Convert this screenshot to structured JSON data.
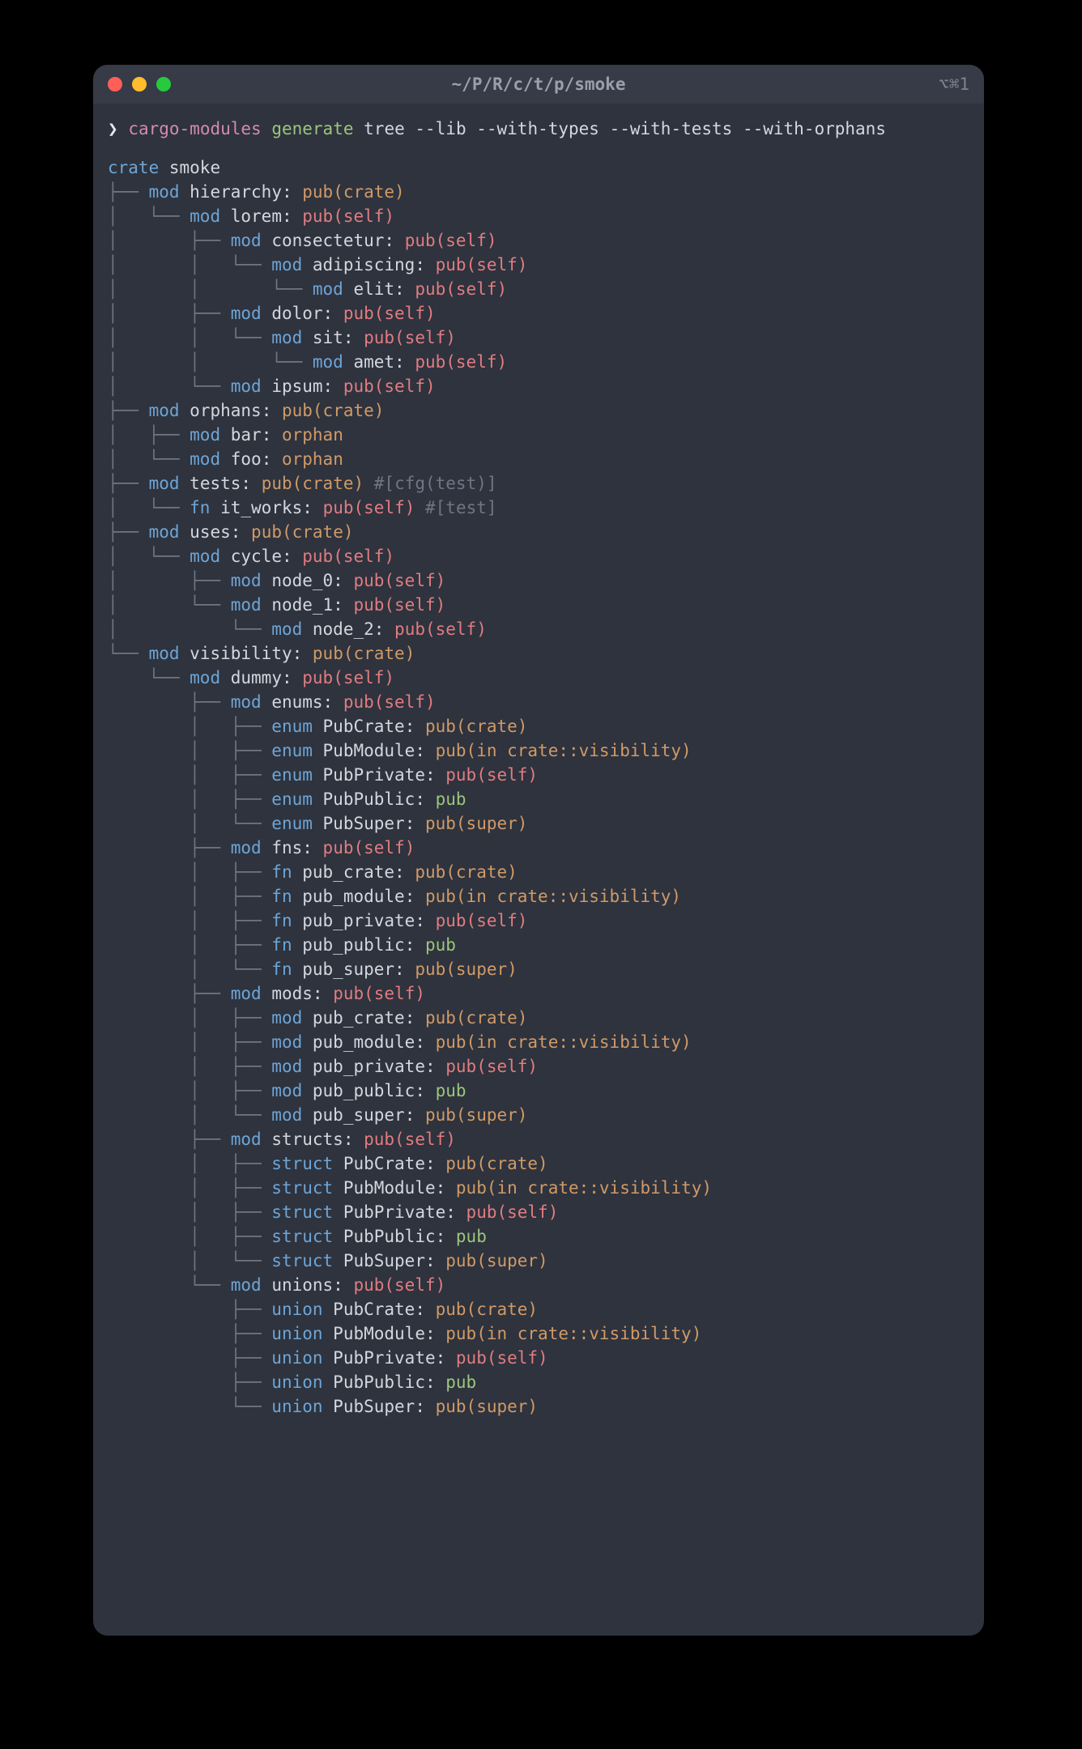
{
  "window": {
    "title": "~/P/R/c/t/p/smoke",
    "shortcut": "⌥⌘1"
  },
  "prompt": {
    "symbol": "❯",
    "binary": "cargo-modules",
    "subcmd": "generate",
    "args": "tree --lib --with-types --with-tests --with-orphans"
  },
  "root": {
    "kw": "crate",
    "name": "smoke"
  },
  "tree": [
    {
      "d": 1,
      "conn": "├── ",
      "kw": "mod",
      "name": "hierarchy",
      "vis": "pub(crate)",
      "vcls": "c-orange"
    },
    {
      "d": 1,
      "conn": "│   └── ",
      "kw": "mod",
      "name": "lorem",
      "vis": "pub(self)",
      "vcls": "c-salmon"
    },
    {
      "d": 1,
      "conn": "│       ├── ",
      "kw": "mod",
      "name": "consectetur",
      "vis": "pub(self)",
      "vcls": "c-salmon"
    },
    {
      "d": 1,
      "conn": "│       │   └── ",
      "kw": "mod",
      "name": "adipiscing",
      "vis": "pub(self)",
      "vcls": "c-salmon"
    },
    {
      "d": 1,
      "conn": "│       │       └── ",
      "kw": "mod",
      "name": "elit",
      "vis": "pub(self)",
      "vcls": "c-salmon"
    },
    {
      "d": 1,
      "conn": "│       ├── ",
      "kw": "mod",
      "name": "dolor",
      "vis": "pub(self)",
      "vcls": "c-salmon"
    },
    {
      "d": 1,
      "conn": "│       │   └── ",
      "kw": "mod",
      "name": "sit",
      "vis": "pub(self)",
      "vcls": "c-salmon"
    },
    {
      "d": 1,
      "conn": "│       │       └── ",
      "kw": "mod",
      "name": "amet",
      "vis": "pub(self)",
      "vcls": "c-salmon"
    },
    {
      "d": 1,
      "conn": "│       └── ",
      "kw": "mod",
      "name": "ipsum",
      "vis": "pub(self)",
      "vcls": "c-salmon"
    },
    {
      "d": 1,
      "conn": "├── ",
      "kw": "mod",
      "name": "orphans",
      "vis": "pub(crate)",
      "vcls": "c-orange"
    },
    {
      "d": 1,
      "conn": "│   ├── ",
      "kw": "mod",
      "name": "bar",
      "vis": "orphan",
      "vcls": "c-orange"
    },
    {
      "d": 1,
      "conn": "│   └── ",
      "kw": "mod",
      "name": "foo",
      "vis": "orphan",
      "vcls": "c-orange"
    },
    {
      "d": 1,
      "conn": "├── ",
      "kw": "mod",
      "name": "tests",
      "vis": "pub(crate)",
      "vcls": "c-orange",
      "attr": "#[cfg(test)]"
    },
    {
      "d": 1,
      "conn": "│   └── ",
      "kw": "fn",
      "name": "it_works",
      "vis": "pub(self)",
      "vcls": "c-salmon",
      "attr": "#[test]"
    },
    {
      "d": 1,
      "conn": "├── ",
      "kw": "mod",
      "name": "uses",
      "vis": "pub(crate)",
      "vcls": "c-orange"
    },
    {
      "d": 1,
      "conn": "│   └── ",
      "kw": "mod",
      "name": "cycle",
      "vis": "pub(self)",
      "vcls": "c-salmon"
    },
    {
      "d": 1,
      "conn": "│       ├── ",
      "kw": "mod",
      "name": "node_0",
      "vis": "pub(self)",
      "vcls": "c-salmon"
    },
    {
      "d": 1,
      "conn": "│       └── ",
      "kw": "mod",
      "name": "node_1",
      "vis": "pub(self)",
      "vcls": "c-salmon"
    },
    {
      "d": 1,
      "conn": "│           └── ",
      "kw": "mod",
      "name": "node_2",
      "vis": "pub(self)",
      "vcls": "c-salmon"
    },
    {
      "d": 1,
      "conn": "└── ",
      "kw": "mod",
      "name": "visibility",
      "vis": "pub(crate)",
      "vcls": "c-orange"
    },
    {
      "d": 1,
      "conn": "    └── ",
      "kw": "mod",
      "name": "dummy",
      "vis": "pub(self)",
      "vcls": "c-salmon"
    },
    {
      "d": 1,
      "conn": "        ├── ",
      "kw": "mod",
      "name": "enums",
      "vis": "pub(self)",
      "vcls": "c-salmon"
    },
    {
      "d": 1,
      "conn": "        │   ├── ",
      "kw": "enum",
      "name": "PubCrate",
      "vis": "pub(crate)",
      "vcls": "c-orange"
    },
    {
      "d": 1,
      "conn": "        │   ├── ",
      "kw": "enum",
      "name": "PubModule",
      "vis": "pub(in crate::visibility)",
      "vcls": "c-orange"
    },
    {
      "d": 1,
      "conn": "        │   ├── ",
      "kw": "enum",
      "name": "PubPrivate",
      "vis": "pub(self)",
      "vcls": "c-salmon"
    },
    {
      "d": 1,
      "conn": "        │   ├── ",
      "kw": "enum",
      "name": "PubPublic",
      "vis": "pub",
      "vcls": "c-green"
    },
    {
      "d": 1,
      "conn": "        │   └── ",
      "kw": "enum",
      "name": "PubSuper",
      "vis": "pub(super)",
      "vcls": "c-orange"
    },
    {
      "d": 1,
      "conn": "        ├── ",
      "kw": "mod",
      "name": "fns",
      "vis": "pub(self)",
      "vcls": "c-salmon"
    },
    {
      "d": 1,
      "conn": "        │   ├── ",
      "kw": "fn",
      "name": "pub_crate",
      "vis": "pub(crate)",
      "vcls": "c-orange"
    },
    {
      "d": 1,
      "conn": "        │   ├── ",
      "kw": "fn",
      "name": "pub_module",
      "vis": "pub(in crate::visibility)",
      "vcls": "c-orange"
    },
    {
      "d": 1,
      "conn": "        │   ├── ",
      "kw": "fn",
      "name": "pub_private",
      "vis": "pub(self)",
      "vcls": "c-salmon"
    },
    {
      "d": 1,
      "conn": "        │   ├── ",
      "kw": "fn",
      "name": "pub_public",
      "vis": "pub",
      "vcls": "c-green"
    },
    {
      "d": 1,
      "conn": "        │   └── ",
      "kw": "fn",
      "name": "pub_super",
      "vis": "pub(super)",
      "vcls": "c-orange"
    },
    {
      "d": 1,
      "conn": "        ├── ",
      "kw": "mod",
      "name": "mods",
      "vis": "pub(self)",
      "vcls": "c-salmon"
    },
    {
      "d": 1,
      "conn": "        │   ├── ",
      "kw": "mod",
      "name": "pub_crate",
      "vis": "pub(crate)",
      "vcls": "c-orange"
    },
    {
      "d": 1,
      "conn": "        │   ├── ",
      "kw": "mod",
      "name": "pub_module",
      "vis": "pub(in crate::visibility)",
      "vcls": "c-orange"
    },
    {
      "d": 1,
      "conn": "        │   ├── ",
      "kw": "mod",
      "name": "pub_private",
      "vis": "pub(self)",
      "vcls": "c-salmon"
    },
    {
      "d": 1,
      "conn": "        │   ├── ",
      "kw": "mod",
      "name": "pub_public",
      "vis": "pub",
      "vcls": "c-green"
    },
    {
      "d": 1,
      "conn": "        │   └── ",
      "kw": "mod",
      "name": "pub_super",
      "vis": "pub(super)",
      "vcls": "c-orange"
    },
    {
      "d": 1,
      "conn": "        ├── ",
      "kw": "mod",
      "name": "structs",
      "vis": "pub(self)",
      "vcls": "c-salmon"
    },
    {
      "d": 1,
      "conn": "        │   ├── ",
      "kw": "struct",
      "name": "PubCrate",
      "vis": "pub(crate)",
      "vcls": "c-orange"
    },
    {
      "d": 1,
      "conn": "        │   ├── ",
      "kw": "struct",
      "name": "PubModule",
      "vis": "pub(in crate::visibility)",
      "vcls": "c-orange"
    },
    {
      "d": 1,
      "conn": "        │   ├── ",
      "kw": "struct",
      "name": "PubPrivate",
      "vis": "pub(self)",
      "vcls": "c-salmon"
    },
    {
      "d": 1,
      "conn": "        │   ├── ",
      "kw": "struct",
      "name": "PubPublic",
      "vis": "pub",
      "vcls": "c-green"
    },
    {
      "d": 1,
      "conn": "        │   └── ",
      "kw": "struct",
      "name": "PubSuper",
      "vis": "pub(super)",
      "vcls": "c-orange"
    },
    {
      "d": 1,
      "conn": "        └── ",
      "kw": "mod",
      "name": "unions",
      "vis": "pub(self)",
      "vcls": "c-salmon"
    },
    {
      "d": 1,
      "conn": "            ├── ",
      "kw": "union",
      "name": "PubCrate",
      "vis": "pub(crate)",
      "vcls": "c-orange"
    },
    {
      "d": 1,
      "conn": "            ├── ",
      "kw": "union",
      "name": "PubModule",
      "vis": "pub(in crate::visibility)",
      "vcls": "c-orange"
    },
    {
      "d": 1,
      "conn": "            ├── ",
      "kw": "union",
      "name": "PubPrivate",
      "vis": "pub(self)",
      "vcls": "c-salmon"
    },
    {
      "d": 1,
      "conn": "            ├── ",
      "kw": "union",
      "name": "PubPublic",
      "vis": "pub",
      "vcls": "c-green"
    },
    {
      "d": 1,
      "conn": "            └── ",
      "kw": "union",
      "name": "PubSuper",
      "vis": "pub(super)",
      "vcls": "c-orange"
    }
  ]
}
